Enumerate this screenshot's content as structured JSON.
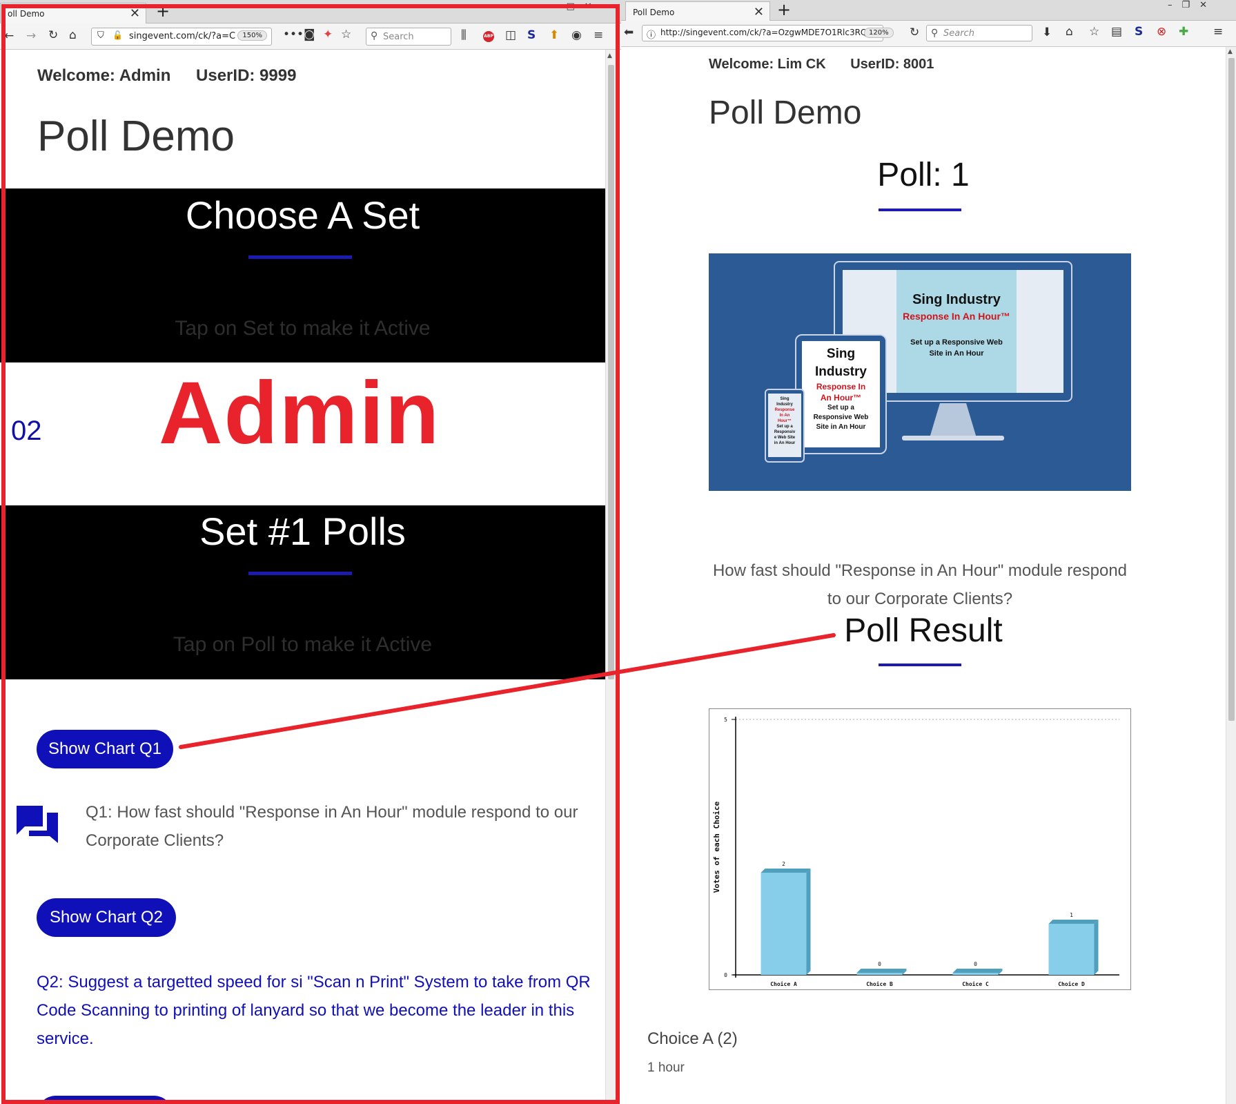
{
  "left": {
    "tab_title": "oll Demo",
    "url": "singevent.com/ck/?a=C",
    "zoom": "150%",
    "search_placeholder": "Search",
    "welcome": "Welcome: Admin",
    "userid": "UserID: 9999",
    "title": "Poll Demo",
    "set_section": {
      "title": "Choose A Set",
      "hint": "Tap on Set to make it Active"
    },
    "set_number": "02",
    "set_name": "Admin",
    "polls_section": {
      "title": "Set #1 Polls",
      "hint": "Tap on Poll to make it Active"
    },
    "q1_button": "Show Chart Q1",
    "q1_text": "Q1: How fast should \"Response in An Hour\" module respond to our Corporate Clients?",
    "q2_button": "Show Chart Q2",
    "q2_text": "Q2: Suggest a targetted speed for si \"Scan n Print\" System to take from QR Code Scanning to printing of lanyard so that we become the leader in this service."
  },
  "right": {
    "tab_title": "Poll Demo",
    "url": "http://singevent.com/ck/?a=OzgwMDE7O1Rlc3RQ",
    "zoom": "120%",
    "search_placeholder": "Search",
    "welcome": "Welcome: Lim CK",
    "userid": "UserID: 8001",
    "title": "Poll Demo",
    "poll_heading": "Poll: 1",
    "banner": {
      "title_large": "Sing Industry",
      "subtitle_large": "Response In An Hour™",
      "tagline_large": "Set up a Responsive Web Site in An Hour",
      "title_mid_1": "Sing",
      "title_mid_2": "Industry",
      "subtitle_mid_1": "Response In",
      "subtitle_mid_2": "An Hour™",
      "tagline_mid_1": "Set up a",
      "tagline_mid_2": "Responsive Web",
      "tagline_mid_3": "Site in An Hour",
      "small_1": "Sing",
      "small_2": "Industry",
      "small_3": "Response",
      "small_4": "In An",
      "small_5": "Hour™",
      "small_6": "Set up a",
      "small_7": "Responsiv",
      "small_8": "e Web Site",
      "small_9": "in An Hour"
    },
    "question": "How fast should \"Response in An Hour\" module respond to our Corporate Clients?",
    "result_heading": "Poll Result",
    "choice_line": "Choice A (2)",
    "choice_sub": "1 hour"
  },
  "colors": {
    "accent_blue": "#1010b8",
    "frame_red": "#e8232b",
    "bar_fill": "#87ceeb",
    "bar_side": "#4f9fbd",
    "banner_bg": "#2c5a95"
  },
  "icons": {
    "chat": "chat-bubbles-icon",
    "back": "back-arrow-icon",
    "forward": "forward-arrow-icon",
    "reload": "reload-icon",
    "home": "home-icon",
    "star": "bookmark-star-icon",
    "menu": "hamburger-menu-icon"
  },
  "chart_data": {
    "type": "bar",
    "categories": [
      "Choice A",
      "Choice B",
      "Choice C",
      "Choice D"
    ],
    "values": [
      2,
      0,
      0,
      1
    ],
    "data_labels": [
      "2",
      "0",
      "0",
      "1"
    ],
    "ylabel": "Votes of each Choice",
    "xlabel": "",
    "ylim": [
      0,
      5
    ],
    "yticks": [
      "0",
      "5"
    ],
    "grid": "top dashed line"
  }
}
